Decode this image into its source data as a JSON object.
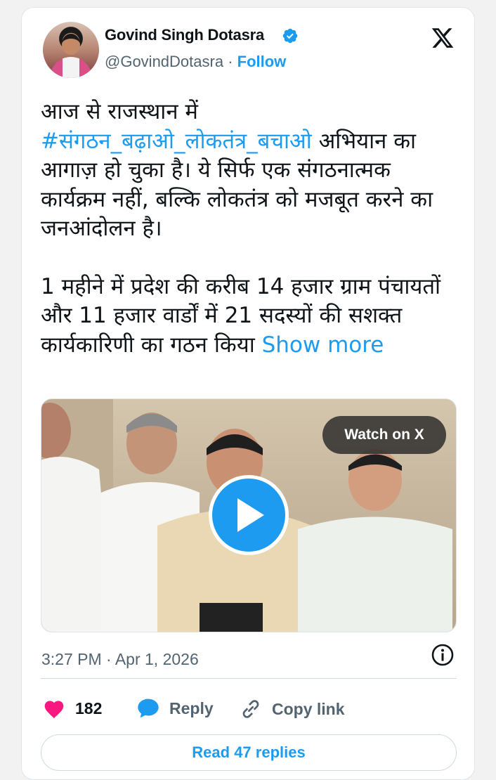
{
  "tweet": {
    "author_name": "Govind Singh Dotasra",
    "handle": "@GovindDotasra",
    "separator": " · ",
    "follow_label": "Follow",
    "text": {
      "line1": "आज से राजस्थान में",
      "hashtag": "#संगठन_बढ़ाओ_लोकतंत्र_बचाओ",
      "after_hashtag": " अभियान का आगाज़ हो चुका है। ये सिर्फ एक संगठनात्मक कार्यक्रम नहीं, बल्कि लोकतंत्र को मजबूत करने का जनआंदोलन है।",
      "para2": "1 महीने में प्रदेश की करीब 14 हजार ग्राम पंचायतों और 11 हजार वार्डों में 21 सदस्यों की सशक्त कार्यकारिणी का गठन किया ",
      "show_more": "Show more"
    },
    "media": {
      "watch_label": "Watch on X"
    },
    "timestamp": "3:27 PM · Apr 1, 2026",
    "actions": {
      "like_count": "182",
      "reply_label": "Reply",
      "copy_label": "Copy link"
    },
    "read_replies_label": "Read 47 replies"
  },
  "colors": {
    "accent": "#1d9bf0",
    "like": "#f91880",
    "text": "#0f1419",
    "muted": "#536471"
  },
  "icons": [
    "verified-badge-icon",
    "x-logo-icon",
    "play-icon",
    "info-icon",
    "heart-icon",
    "reply-bubble-icon",
    "link-icon"
  ]
}
